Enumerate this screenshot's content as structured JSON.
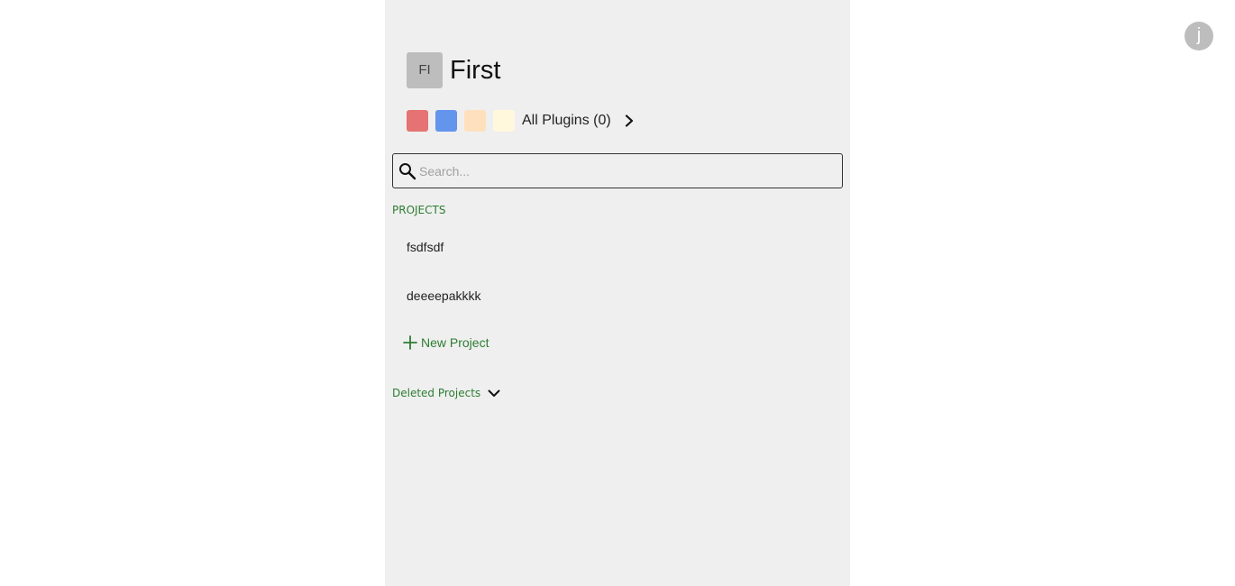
{
  "user": {
    "avatar_initial": "j"
  },
  "workspace": {
    "avatar_initials": "FI",
    "name": "First"
  },
  "plugins": {
    "swatch_colors": [
      "#e57373",
      "#6495ed",
      "#ffe0bd",
      "#fff8dc"
    ],
    "label": "All Plugins (0)"
  },
  "search": {
    "placeholder": "Search...",
    "value": ""
  },
  "projects": {
    "section_label": "PROJECTS",
    "items": [
      {
        "label": "fsdfsdf"
      },
      {
        "label": "deeeepakkkk"
      }
    ],
    "new_label": "New Project"
  },
  "deleted": {
    "label": "Deleted Projects"
  },
  "colors": {
    "panel_bg": "#efefef",
    "accent_green": "#2e7d32",
    "avatar_gray": "#bdbdbd"
  }
}
